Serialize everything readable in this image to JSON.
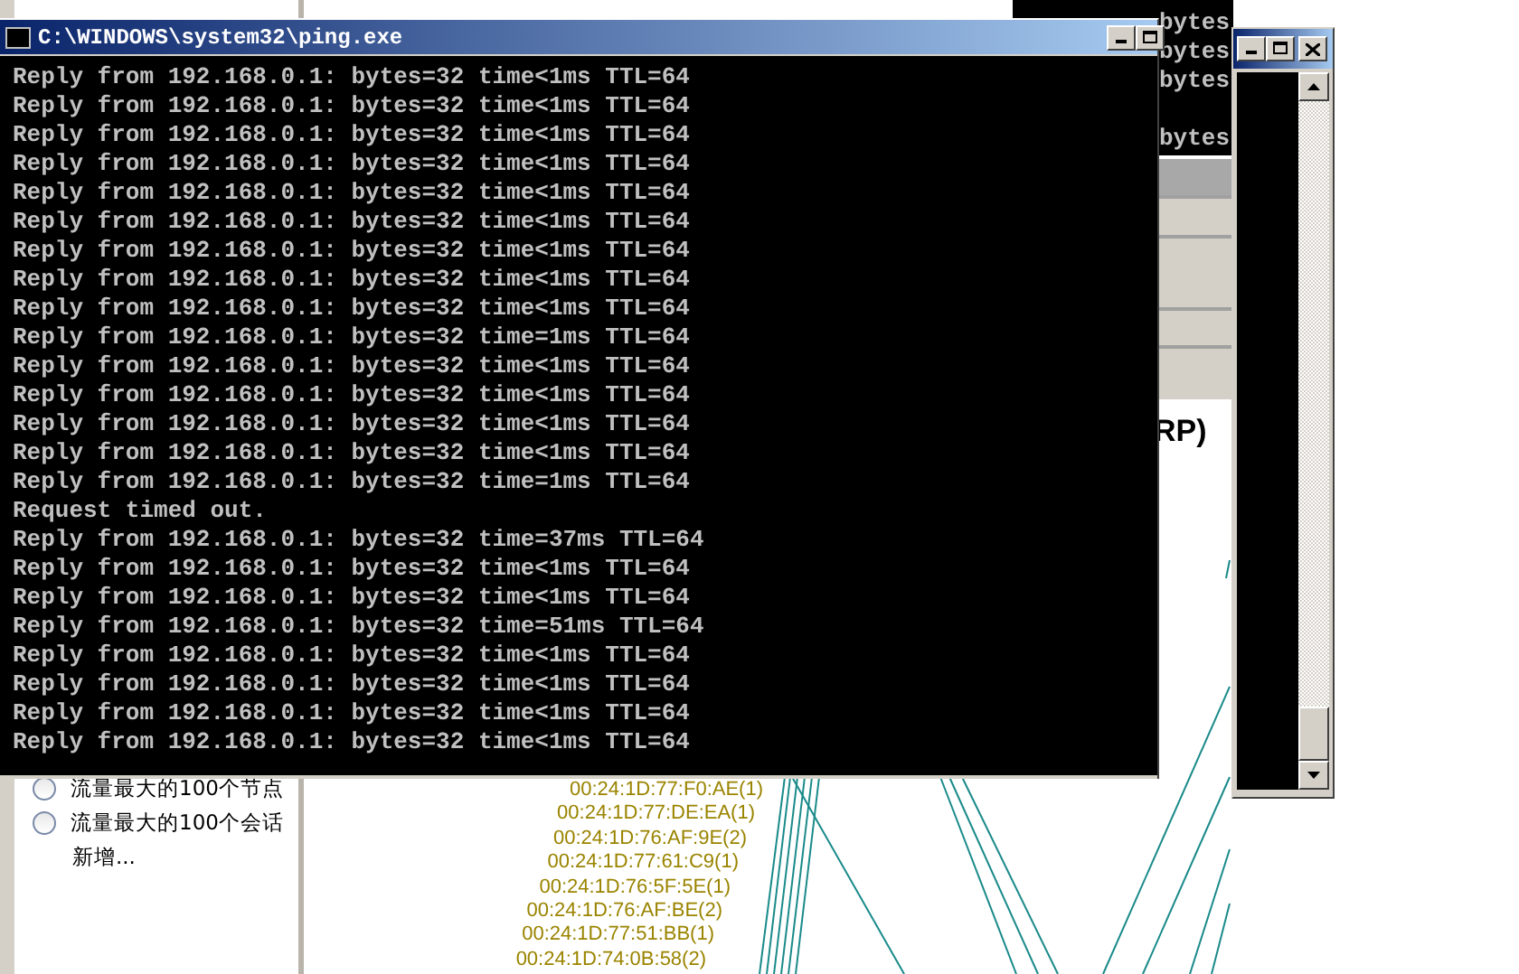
{
  "app_window": {
    "heading_fragment": "RP)",
    "options": [
      {
        "label": "流量最大的100个节点",
        "selected": false
      },
      {
        "label": "流量最大的100个会话",
        "selected": false
      }
    ],
    "add_link": "新增...",
    "graph_nodes": [
      {
        "label": "00:24:1D:77:F0:AE(1)"
      },
      {
        "label": "00:24:1D:77:DE:EA(1)"
      },
      {
        "label": "00:24:1D:76:AF:9E(2)"
      },
      {
        "label": "00:24:1D:77:61:C9(1)"
      },
      {
        "label": "00:24:1D:76:5F:5E(1)"
      },
      {
        "label": "00:24:1D:76:AF:BE(2)"
      },
      {
        "label": "00:24:1D:77:51:BB(1)"
      },
      {
        "label": "00:24:1D:74:0B:58(2)"
      }
    ]
  },
  "console_window_behind": {
    "lines": [
      "bytes",
      "bytes",
      "bytes",
      "bytes"
    ]
  },
  "ping_window": {
    "title": "C:\\WINDOWS\\system32\\ping.exe",
    "lines": [
      "Reply from 192.168.0.1: bytes=32 time<1ms TTL=64",
      "Reply from 192.168.0.1: bytes=32 time<1ms TTL=64",
      "Reply from 192.168.0.1: bytes=32 time<1ms TTL=64",
      "Reply from 192.168.0.1: bytes=32 time<1ms TTL=64",
      "Reply from 192.168.0.1: bytes=32 time<1ms TTL=64",
      "Reply from 192.168.0.1: bytes=32 time<1ms TTL=64",
      "Reply from 192.168.0.1: bytes=32 time<1ms TTL=64",
      "Reply from 192.168.0.1: bytes=32 time<1ms TTL=64",
      "Reply from 192.168.0.1: bytes=32 time<1ms TTL=64",
      "Reply from 192.168.0.1: bytes=32 time=1ms TTL=64",
      "Reply from 192.168.0.1: bytes=32 time<1ms TTL=64",
      "Reply from 192.168.0.1: bytes=32 time<1ms TTL=64",
      "Reply from 192.168.0.1: bytes=32 time<1ms TTL=64",
      "Reply from 192.168.0.1: bytes=32 time<1ms TTL=64",
      "Reply from 192.168.0.1: bytes=32 time=1ms TTL=64",
      "Request timed out.",
      "Reply from 192.168.0.1: bytes=32 time=37ms TTL=64",
      "Reply from 192.168.0.1: bytes=32 time<1ms TTL=64",
      "Reply from 192.168.0.1: bytes=32 time<1ms TTL=64",
      "Reply from 192.168.0.1: bytes=32 time=51ms TTL=64",
      "Reply from 192.168.0.1: bytes=32 time<1ms TTL=64",
      "Reply from 192.168.0.1: bytes=32 time<1ms TTL=64",
      "Reply from 192.168.0.1: bytes=32 time<1ms TTL=64",
      "Reply from 192.168.0.1: bytes=32 time<1ms TTL=64"
    ]
  }
}
